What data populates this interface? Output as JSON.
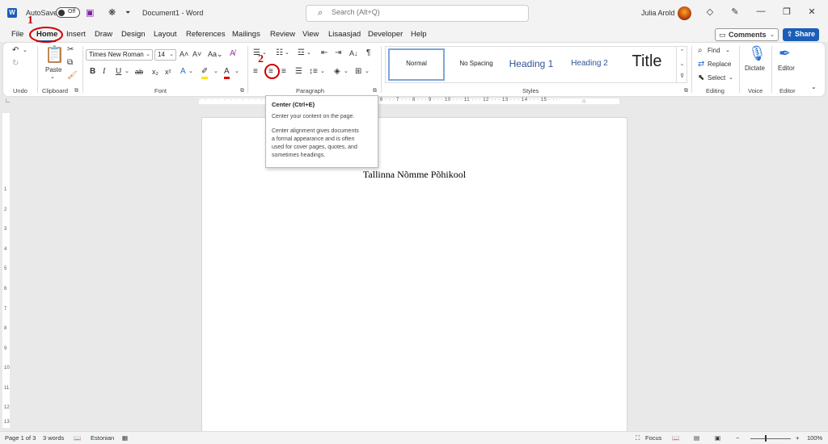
{
  "titlebar": {
    "app_icon": "word-icon",
    "app_letter": "W",
    "autosave_label": "AutoSave",
    "autosave_state": "Off",
    "doc_title": "Document1  -  Word",
    "search_placeholder": "Search (Alt+Q)",
    "user_name": "Julia Arold"
  },
  "menu": {
    "items": [
      "File",
      "Home",
      "Insert",
      "Draw",
      "Design",
      "Layout",
      "References",
      "Mailings",
      "Review",
      "View",
      "Lisaasjad",
      "Developer",
      "Help"
    ],
    "active": "Home",
    "comments_label": "Comments",
    "share_label": "Share"
  },
  "ribbon": {
    "undo_label": "Undo",
    "clipboard_label": "Clipboard",
    "paste_label": "Paste",
    "font_label": "Font",
    "font_name": "Times New Roman",
    "font_size": "14",
    "paragraph_label": "Paragraph",
    "styles_label": "Styles",
    "styles": [
      "Normal",
      "No Spacing",
      "Heading 1",
      "Heading 2",
      "Title"
    ],
    "editing_label": "Editing",
    "find_label": "Find",
    "replace_label": "Replace",
    "select_label": "Select",
    "voice_label": "Voice",
    "dictate_label": "Dictate",
    "editor_group_label": "Editor",
    "editor_label": "Editor"
  },
  "annotations": {
    "step1": "1",
    "step2": "2",
    "color": "#d00000"
  },
  "tooltip": {
    "title": "Center (Ctrl+E)",
    "line1": "Center your content on the page.",
    "desc": [
      "Center alignment gives documents",
      "a formal appearance and is often",
      "used for cover pages, quotes, and",
      "sometimes headings."
    ]
  },
  "ruler": {
    "ticks": "6 · · · 7 · · · 8 · · · 9 · · · 10 · · · 11 · · · 12 · · · 13 · · · 14 · · · 15 · · ·",
    "vertical": [
      "1",
      "2",
      "3",
      "4",
      "5",
      "6",
      "7",
      "8",
      "9",
      "10",
      "11",
      "12",
      "13"
    ]
  },
  "document": {
    "text": "Tallinna Nõmme Põhikool"
  },
  "statusbar": {
    "page": "Page 1 of 3",
    "words": "3 words",
    "language": "Estonian",
    "focus": "Focus",
    "zoom": "100%"
  },
  "colors": {
    "accent": "#1b5eb8",
    "heading_blue": "#2f5496"
  }
}
